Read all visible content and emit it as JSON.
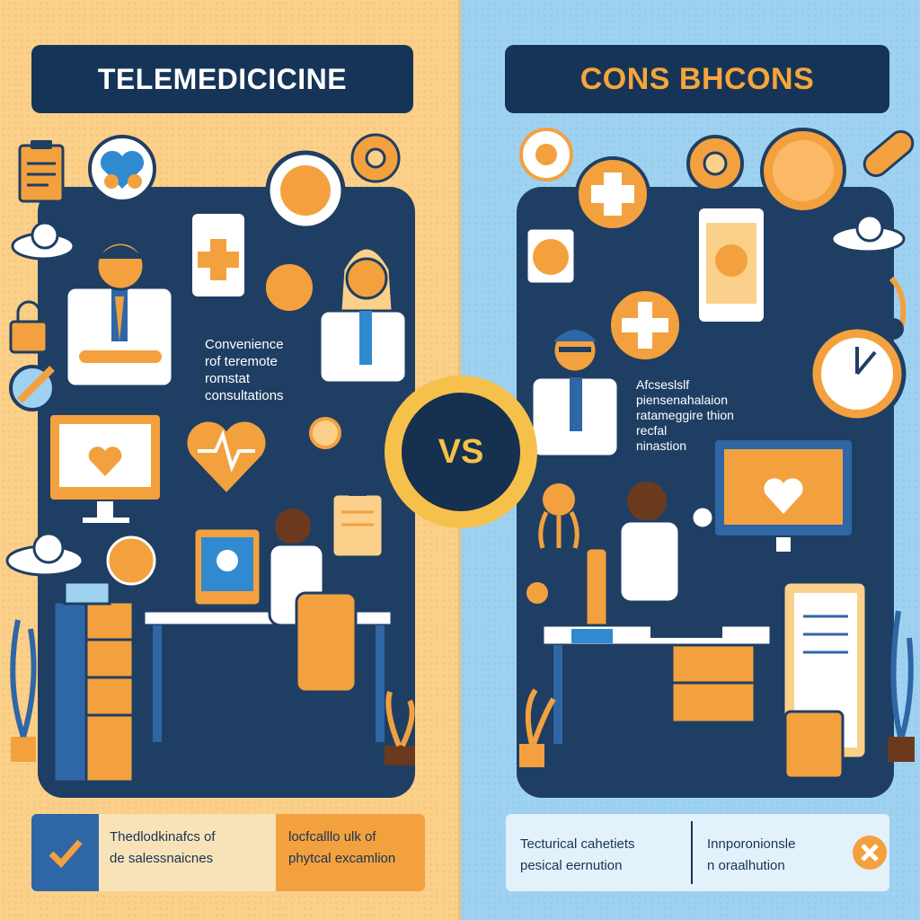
{
  "left_title": "TELEMEDICICINE",
  "right_title": "CONS BHCONS",
  "vs_label": "VS",
  "left_caption": [
    "Convenience",
    "rof teremote",
    "romstat",
    "consultations"
  ],
  "right_caption": [
    "Afcseslslf",
    "piensenahalaion",
    "ratameggire thion",
    "recfal",
    "ninastion"
  ],
  "left_bottom_a": [
    "Thedlodkinafcs of",
    "de salessnaicnes"
  ],
  "left_bottom_b": [
    "locfcalllo ulk of",
    "phytcal excamlion"
  ],
  "right_bottom_a": [
    "Tecturical cahetiets",
    "pesical eernution"
  ],
  "right_bottom_b": [
    "Innporonionsle",
    "n oraalhution"
  ],
  "icons": [
    "check-icon",
    "heart-icon",
    "medical-cross-icon",
    "skull-xray-icon",
    "alarm-clock-icon",
    "stethoscope-icon",
    "clipboard-icon",
    "cloud-icon",
    "plant-icon"
  ],
  "colors": {
    "orange": "#f3a13e",
    "navy": "#1f3e63",
    "light-orange": "#fbd08a",
    "light-blue": "#9fd2f0",
    "yellow": "#f6c14a"
  }
}
